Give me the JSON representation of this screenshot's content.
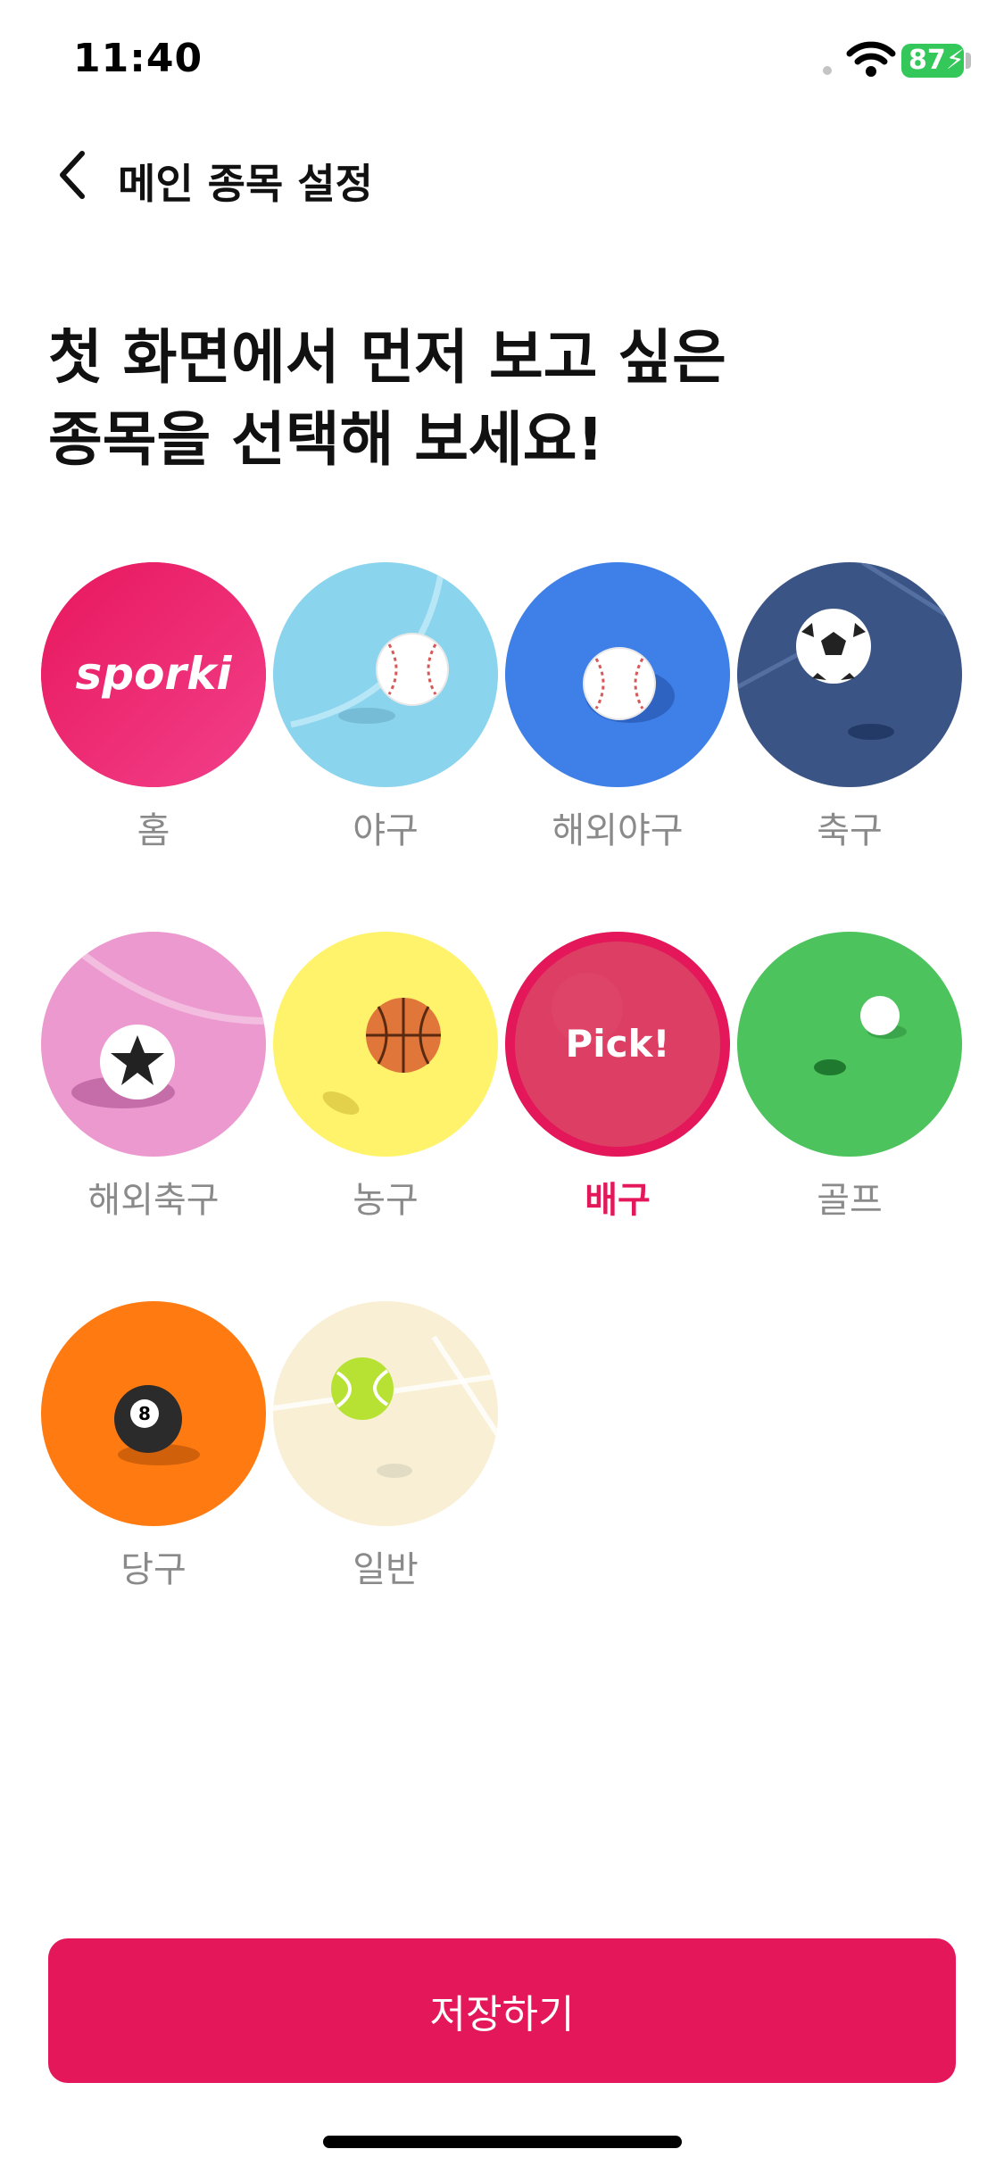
{
  "status_bar": {
    "time": "11:40",
    "battery": "87"
  },
  "nav": {
    "title": "메인 종목 설정",
    "back_icon": "chevron-left-icon"
  },
  "headline": {
    "line1": "첫 화면에서 먼저 보고 싶은",
    "line2": "종목을 선택해 보세요!"
  },
  "sports": [
    {
      "label": "홈",
      "icon": "sporki-logo",
      "color": "#e81e63",
      "selected": false
    },
    {
      "label": "야구",
      "icon": "baseball-icon",
      "color": "#8ad4ee",
      "selected": false
    },
    {
      "label": "해외야구",
      "icon": "baseball-icon",
      "color": "#3f7fe8",
      "selected": false
    },
    {
      "label": "축구",
      "icon": "soccer-ball-icon",
      "color": "#3b5486",
      "selected": false
    },
    {
      "label": "해외축구",
      "icon": "star-ball-icon",
      "color": "#ec99cf",
      "selected": false
    },
    {
      "label": "농구",
      "icon": "basketball-icon",
      "color": "#fff36b",
      "selected": false
    },
    {
      "label": "배구",
      "icon": "volleyball-icon",
      "color": "#e3175a",
      "selected": true
    },
    {
      "label": "골프",
      "icon": "golf-ball-icon",
      "color": "#4cc35c",
      "selected": false
    },
    {
      "label": "당구",
      "icon": "eight-ball-icon",
      "color": "#ff7b12",
      "selected": false
    },
    {
      "label": "일반",
      "icon": "tennis-ball-icon",
      "color": "#f9efd5",
      "selected": false
    }
  ],
  "home_logo_text": "sporki",
  "pick_text": "Pick!",
  "save_button": {
    "label": "저장하기"
  },
  "colors": {
    "accent": "#e3175a",
    "label_gray": "#8a8a8a"
  }
}
